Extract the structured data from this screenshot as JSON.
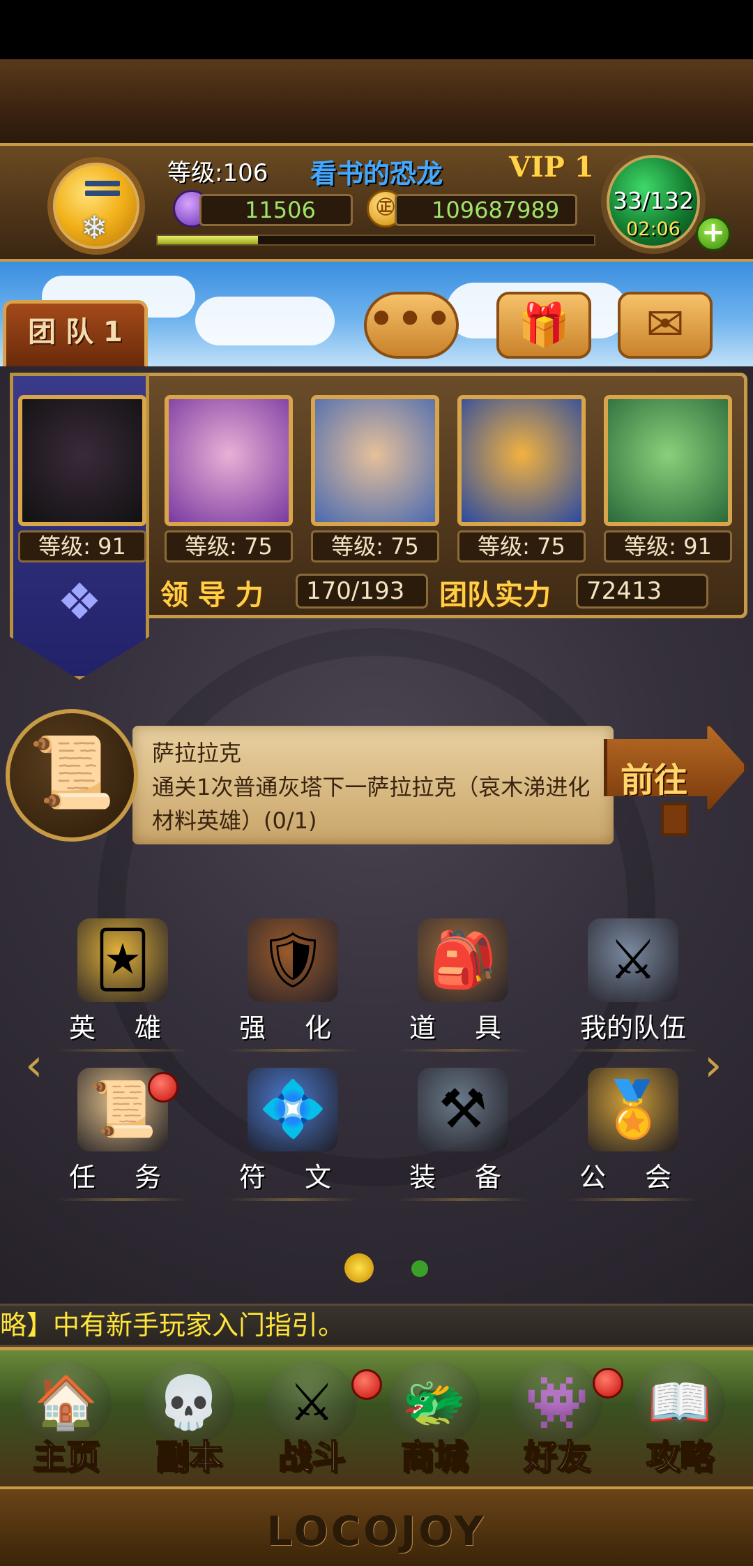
{
  "header": {
    "level_label": "等级:106",
    "player_name": "看书的恐龙",
    "vip": "VIP 1",
    "gems": "11506",
    "gold": "109687989",
    "coin_glyph": "㊣",
    "exp_progress": 0.23,
    "energy": "33/132",
    "energy_timer": "02:06",
    "plus": "+"
  },
  "sky": {
    "team_tab": "团 队 1",
    "chat_glyph": "•••",
    "gift_glyph": "🎁",
    "mail_glyph": "✉"
  },
  "team": {
    "heroes": [
      {
        "level": "等级: 91",
        "colors": [
          "#3a2a3a",
          "#111"
        ]
      },
      {
        "level": "等级: 75",
        "colors": [
          "#e9b0d6",
          "#7a3aa0"
        ]
      },
      {
        "level": "等级: 75",
        "colors": [
          "#e6c09a",
          "#4a6ab0"
        ]
      },
      {
        "level": "等级: 75",
        "colors": [
          "#f2b240",
          "#2a4aa0"
        ]
      },
      {
        "level": "等级: 91",
        "colors": [
          "#8ad07a",
          "#2a6a3a"
        ]
      }
    ],
    "leadership_label": "领 导 力",
    "leadership_value": "170/193",
    "power_label": "团队实力",
    "power_value": "72413",
    "banner_glyph": "❖"
  },
  "quest": {
    "icon_glyph": "📜",
    "title": "萨拉拉克",
    "description": "通关1次普通灰塔下一萨拉拉克（哀木涕进化材料英雄）(0/1)",
    "go_label": "前往"
  },
  "menu": {
    "items": [
      {
        "label": "英 雄",
        "glyph": "🃏",
        "color": "#e2b23a"
      },
      {
        "label": "强 化",
        "glyph": "🛡",
        "color": "#9a5a2a"
      },
      {
        "label": "道 具",
        "glyph": "🎒",
        "color": "#9a6a3a"
      },
      {
        "label": "我的队伍",
        "glyph": "⚔",
        "color": "#7a8aa0"
      },
      {
        "label": "任 务",
        "glyph": "📜",
        "color": "#e0c08a"
      },
      {
        "label": "符 文",
        "glyph": "💠",
        "color": "#4a7ad0"
      },
      {
        "label": "装 备",
        "glyph": "⚒",
        "color": "#6a7a8a"
      },
      {
        "label": "公 会",
        "glyph": "🏅",
        "color": "#d0a03a"
      }
    ],
    "left_arrow": "‹",
    "right_arrow": "›"
  },
  "pager": {
    "current": 1,
    "total": 2
  },
  "marquee": {
    "text": "略】中有新手玩家入门指引。"
  },
  "nav": {
    "items": [
      {
        "label": "主页",
        "glyph": "🏠"
      },
      {
        "label": "副本",
        "glyph": "💀"
      },
      {
        "label": "战斗",
        "glyph": "⚔"
      },
      {
        "label": "商城",
        "glyph": "🐲"
      },
      {
        "label": "好友",
        "glyph": "👾"
      },
      {
        "label": "攻略",
        "glyph": "📖"
      }
    ]
  },
  "footer": {
    "logo": "LOCOJOY"
  },
  "colors": {
    "gold": "#c79a45",
    "accent_blue": "#44a8ff",
    "text_yellow": "#ffe43a"
  }
}
